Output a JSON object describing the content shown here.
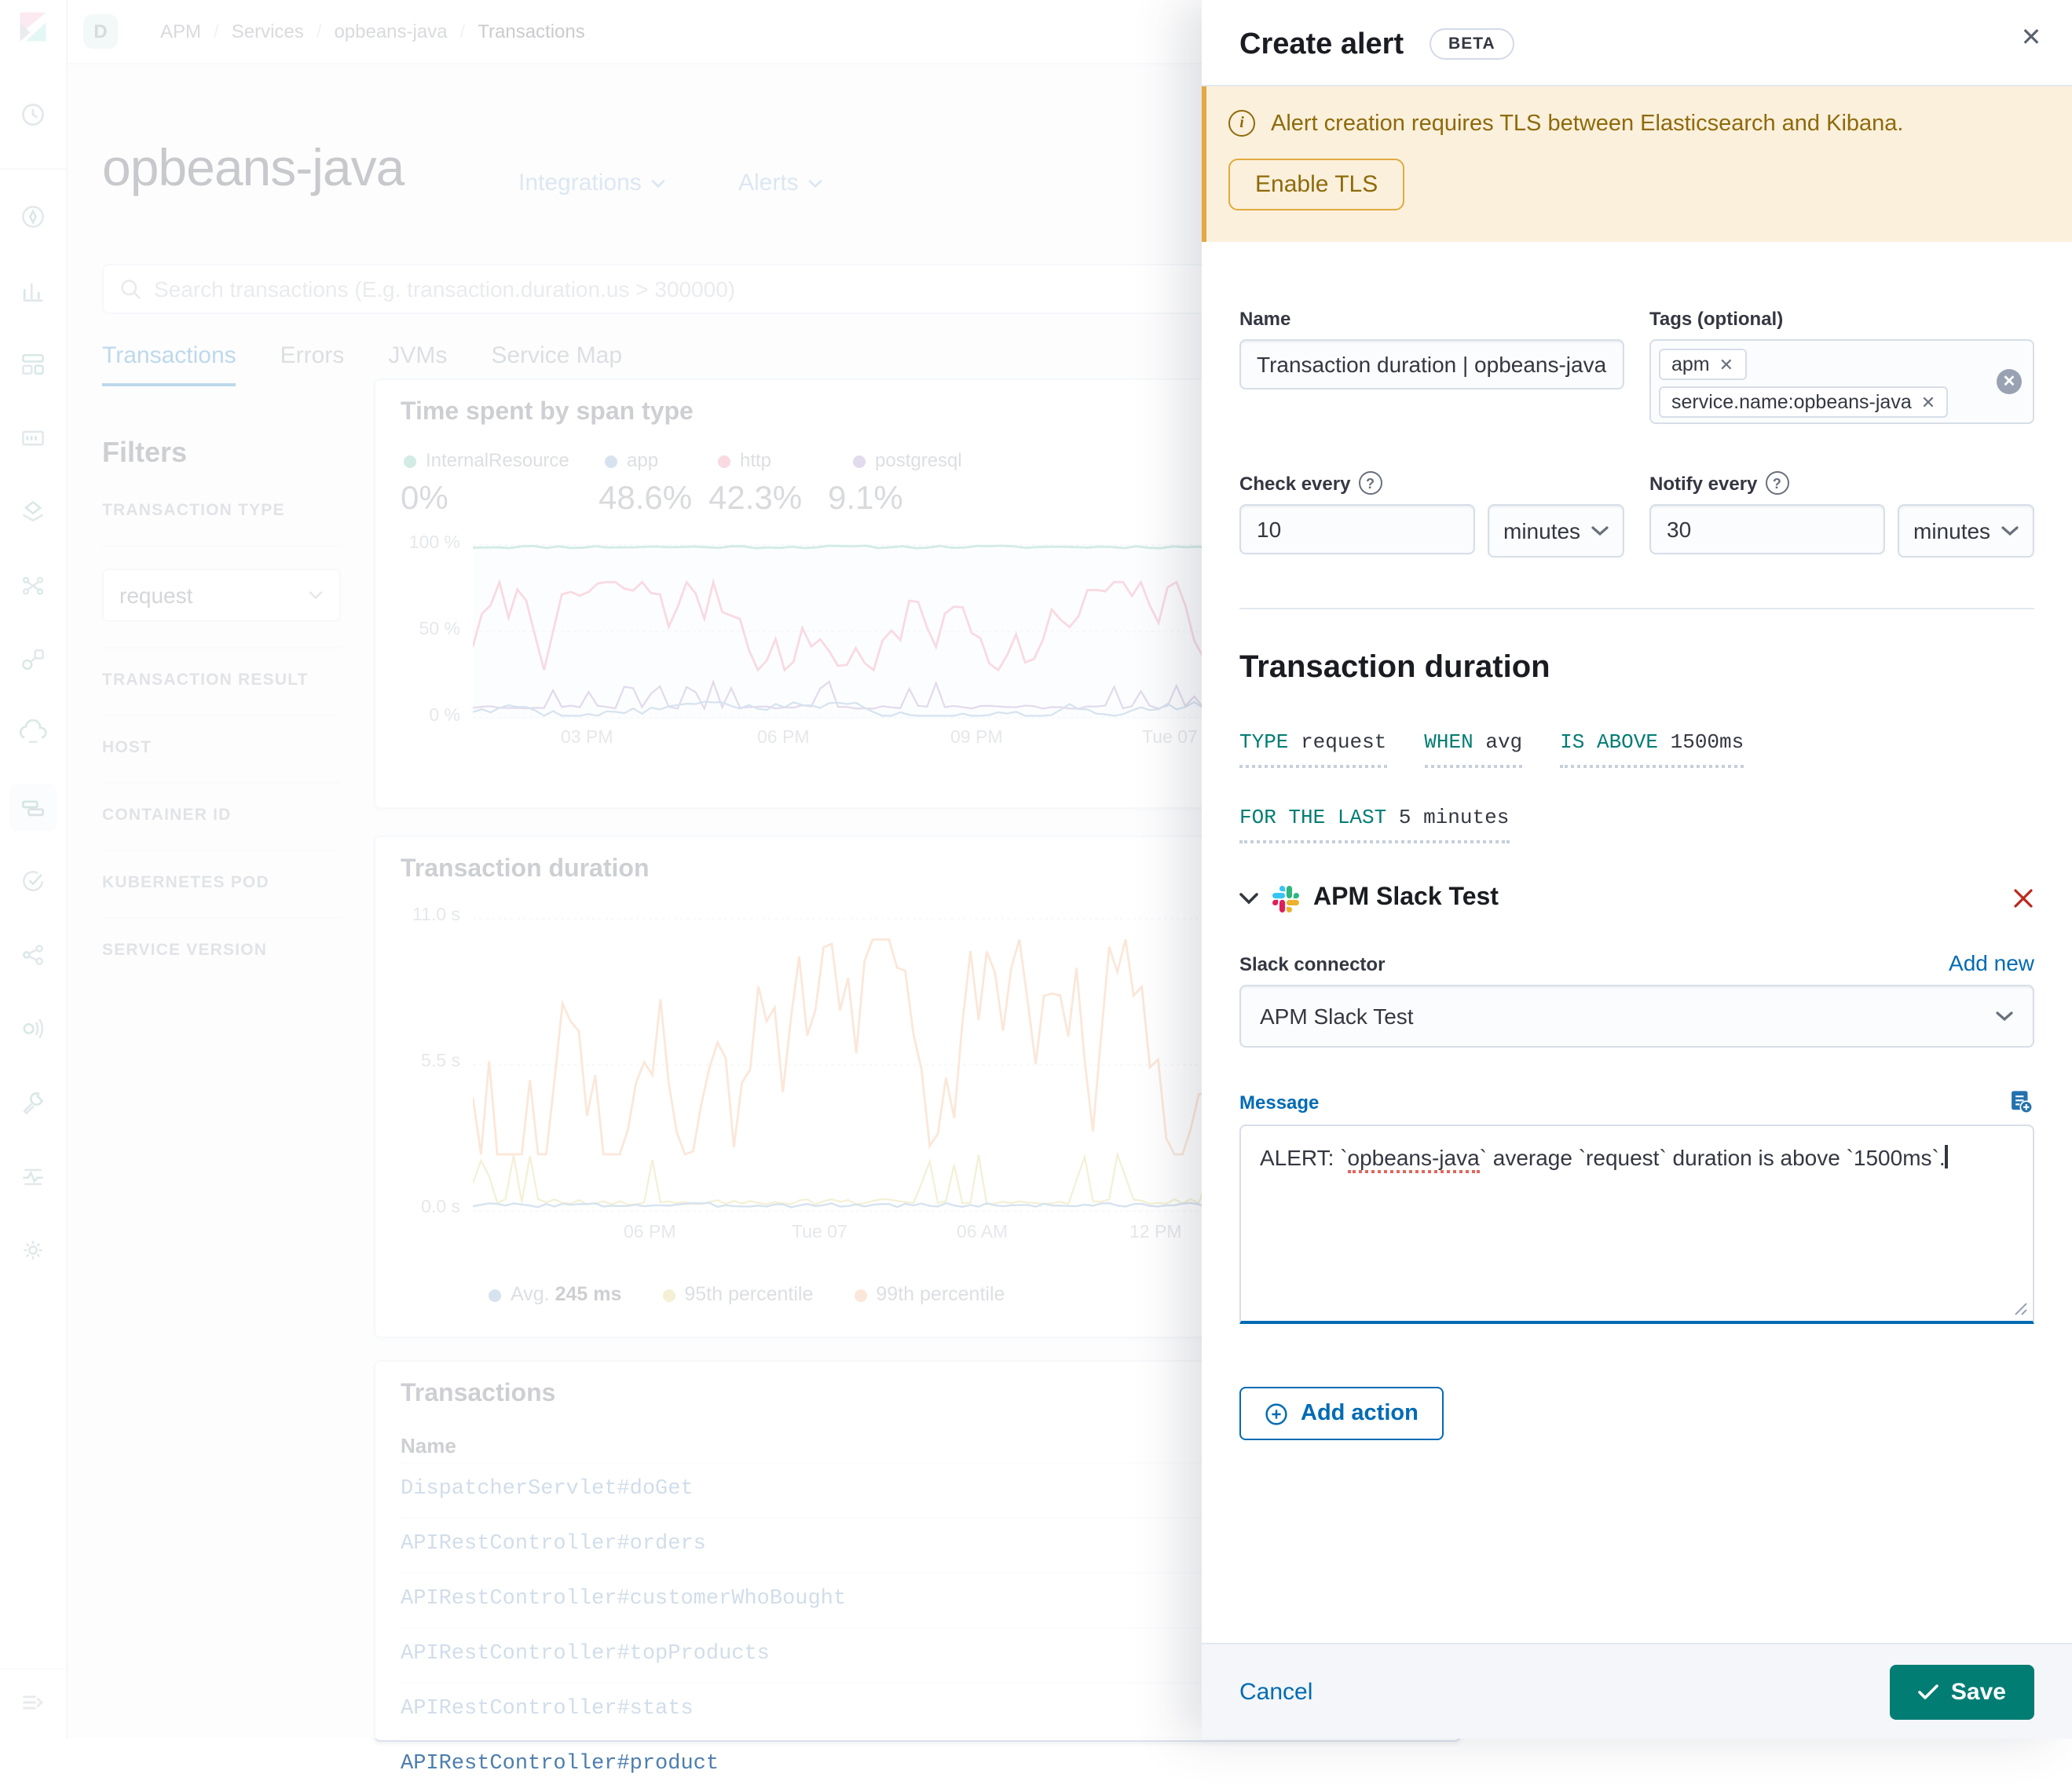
{
  "icons": {
    "close": "✕",
    "remove": "✕",
    "clear": "✕",
    "check": "✓",
    "plus": "+",
    "help": "?",
    "info": "i",
    "slash": "/"
  },
  "header": {
    "breadcrumbs": [
      "APM",
      "Services",
      "opbeans-java",
      "Transactions"
    ],
    "space_badge": "D"
  },
  "nav": {
    "selected": "apm",
    "icons": [
      "recently-viewed",
      "discover",
      "visualize",
      "dashboard",
      "canvas",
      "maps",
      "machine-learning",
      "graph",
      "metrics",
      "apm",
      "uptime",
      "siem",
      "logs",
      "dev-tools",
      "stack-monitoring",
      "management"
    ]
  },
  "service": {
    "title": "opbeans-java",
    "integrations_label": "Integrations",
    "alerts_label": "Alerts",
    "search_placeholder": "Search transactions (E.g. transaction.duration.us > 300000)",
    "tabs": [
      "Transactions",
      "Errors",
      "JVMs",
      "Service Map"
    ],
    "active_tab": "Transactions"
  },
  "filters": {
    "title": "Filters",
    "transaction_type_label": "TRANSACTION TYPE",
    "transaction_type_value": "request",
    "sections": [
      "TRANSACTION RESULT",
      "HOST",
      "CONTAINER ID",
      "KUBERNETES POD",
      "SERVICE VERSION"
    ]
  },
  "charts": {
    "span_type": {
      "type": "line",
      "title": "Time spent by span type",
      "legend": [
        {
          "label": "InternalResource",
          "color": "#54B399",
          "percent": "0%"
        },
        {
          "label": "app",
          "color": "#6092C0",
          "percent": "48.6%"
        },
        {
          "label": "http",
          "color": "#E8708F",
          "percent": "42.3%"
        },
        {
          "label": "postgresql",
          "color": "#9170B8",
          "percent": "9.1%"
        }
      ],
      "yticks": [
        "100 %",
        "50 %",
        "0 %"
      ],
      "xticks": [
        "03 PM",
        "06 PM",
        "09 PM",
        "Tue 07"
      ],
      "ylim": [
        0,
        100
      ]
    },
    "duration": {
      "type": "line",
      "title": "Transaction duration",
      "yticks": [
        "11.0 s",
        "5.5 s",
        "0.0 s"
      ],
      "xticks": [
        "06 PM",
        "Tue 07",
        "06 AM",
        "12 PM"
      ],
      "ylim": [
        0,
        11
      ],
      "legend": [
        {
          "label": "Avg.",
          "value": "245 ms",
          "color": "#6092C0"
        },
        {
          "label": "95th percentile",
          "value": "",
          "color": "#D2C45C"
        },
        {
          "label": "99th percentile",
          "value": "",
          "color": "#EFA26B"
        }
      ]
    }
  },
  "transactions": {
    "title": "Transactions",
    "column": "Name",
    "rows": [
      "DispatcherServlet#doGet",
      "APIRestController#orders",
      "APIRestController#customerWhoBought",
      "APIRestController#topProducts",
      "APIRestController#stats",
      "APIRestController#product"
    ]
  },
  "flyout": {
    "title": "Create alert",
    "beta": "BETA",
    "callout": {
      "text": "Alert creation requires TLS between Elasticsearch and Kibana.",
      "button": "Enable TLS"
    },
    "fields": {
      "name_label": "Name",
      "name_value": "Transaction duration | opbeans-java",
      "tags_label": "Tags (optional)",
      "tags": [
        "apm",
        "service.name:opbeans-java"
      ],
      "check_label": "Check every",
      "check_value": "10",
      "check_unit": "minutes",
      "notify_label": "Notify every",
      "notify_value": "30",
      "notify_unit": "minutes"
    },
    "condition": {
      "heading": "Transaction duration",
      "expressions": [
        {
          "key": "TYPE",
          "value": "request"
        },
        {
          "key": "WHEN",
          "value": "avg"
        },
        {
          "key": "IS ABOVE",
          "value": "1500ms"
        },
        {
          "key": "FOR THE LAST",
          "value": "5 minutes"
        }
      ]
    },
    "action": {
      "title": "APM Slack Test",
      "connector_label": "Slack connector",
      "add_new": "Add new",
      "connector_value": "APM Slack Test",
      "message_label": "Message",
      "message_prefix": "ALERT: `",
      "message_service": "opbeans-java",
      "message_suffix": "` average `request` duration is above `1500ms`."
    },
    "add_action": "Add action",
    "footer": {
      "cancel": "Cancel",
      "save": "Save"
    }
  },
  "colors": {
    "primary": "#006BB4",
    "secondary": "#017D73",
    "danger": "#BD271E",
    "warning_text": "#8E6A0B",
    "warning_border": "#E2A93D"
  }
}
